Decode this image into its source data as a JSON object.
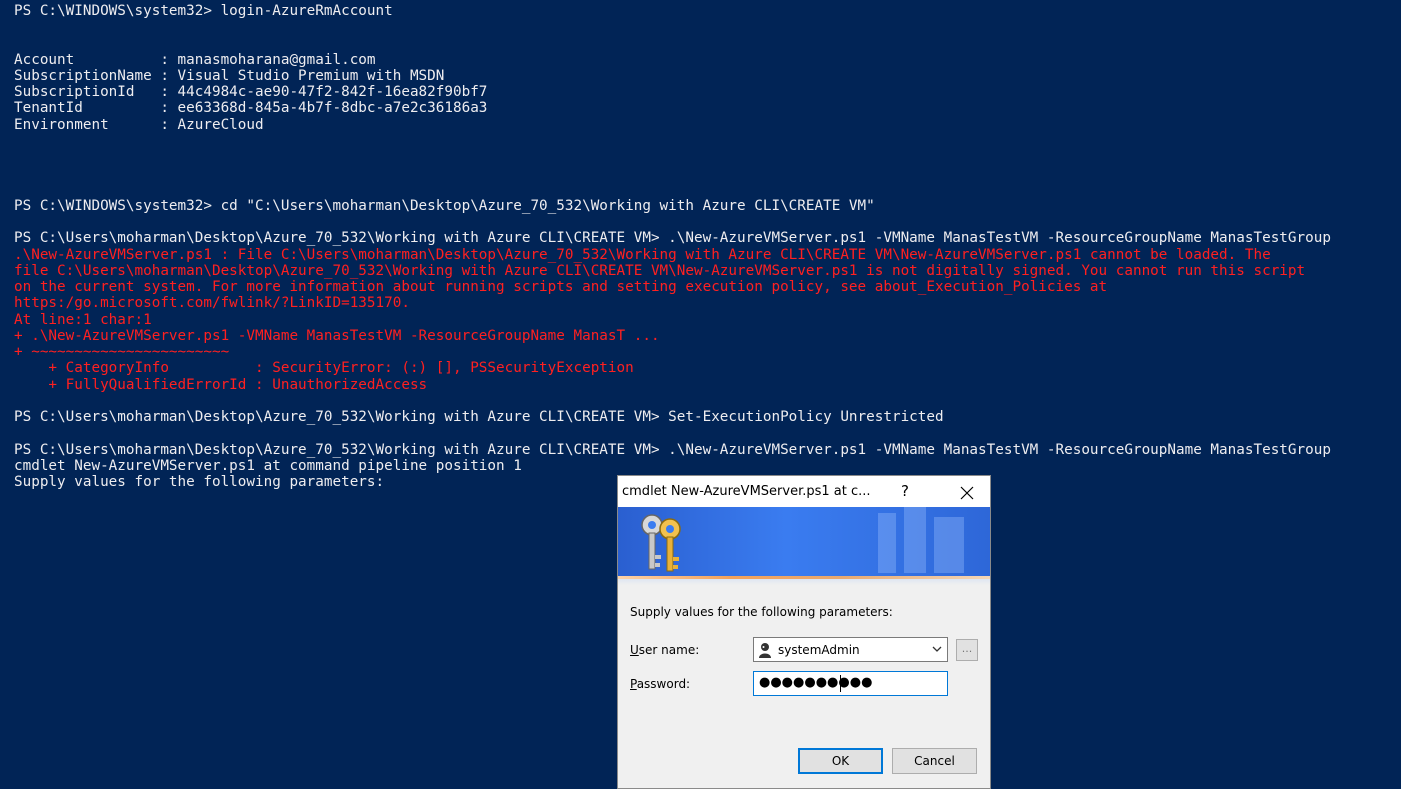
{
  "console": {
    "lines": [
      {
        "text": "PS C:\\WINDOWS\\system32> login-AzureRmAccount",
        "error": false
      },
      {
        "text": "Account          : manasmoharana@gmail.com",
        "error": false
      },
      {
        "text": "SubscriptionName : Visual Studio Premium with MSDN",
        "error": false
      },
      {
        "text": "SubscriptionId   : 44c4984c-ae90-47f2-842f-16ea82f90bf7",
        "error": false
      },
      {
        "text": "TenantId         : ee63368d-845a-4b7f-8dbc-a7e2c36186a3",
        "error": false
      },
      {
        "text": "Environment      : AzureCloud",
        "error": false
      },
      {
        "text": "PS C:\\WINDOWS\\system32> cd \"C:\\Users\\moharman\\Desktop\\Azure_70_532\\Working with Azure CLI\\CREATE VM\"",
        "error": false
      },
      {
        "text": "PS C:\\Users\\moharman\\Desktop\\Azure_70_532\\Working with Azure CLI\\CREATE VM> .\\New-AzureVMServer.ps1 -VMName ManasTestVM -ResourceGroupName ManasTestGroup",
        "error": false
      },
      {
        "text": ".\\New-AzureVMServer.ps1 : File C:\\Users\\moharman\\Desktop\\Azure_70_532\\Working with Azure CLI\\CREATE VM\\New-AzureVMServer.ps1 cannot be loaded. The",
        "error": true
      },
      {
        "text": "file C:\\Users\\moharman\\Desktop\\Azure_70_532\\Working with Azure CLI\\CREATE VM\\New-AzureVMServer.ps1 is not digitally signed. You cannot run this script",
        "error": true
      },
      {
        "text": "on the current system. For more information about running scripts and setting execution policy, see about_Execution_Policies at",
        "error": true
      },
      {
        "text": "https:/go.microsoft.com/fwlink/?LinkID=135170.",
        "error": true
      },
      {
        "text": "At line:1 char:1",
        "error": true
      },
      {
        "text": "+ .\\New-AzureVMServer.ps1 -VMName ManasTestVM -ResourceGroupName ManasT ...",
        "error": true
      },
      {
        "text": "+ ~~~~~~~~~~~~~~~~~~~~~~~",
        "error": true
      },
      {
        "text": "    + CategoryInfo          : SecurityError: (:) [], PSSecurityException",
        "error": true
      },
      {
        "text": "    + FullyQualifiedErrorId : UnauthorizedAccess",
        "error": true
      },
      {
        "text": "PS C:\\Users\\moharman\\Desktop\\Azure_70_532\\Working with Azure CLI\\CREATE VM> Set-ExecutionPolicy Unrestricted",
        "error": false
      },
      {
        "text": "PS C:\\Users\\moharman\\Desktop\\Azure_70_532\\Working with Azure CLI\\CREATE VM> .\\New-AzureVMServer.ps1 -VMName ManasTestVM -ResourceGroupName ManasTestGroup",
        "error": false
      },
      {
        "text": "cmdlet New-AzureVMServer.ps1 at command pipeline position 1",
        "error": false
      },
      {
        "text": "Supply values for the following parameters:",
        "error": false
      }
    ]
  },
  "dialog": {
    "title": "cmdlet New-AzureVMServer.ps1 at c...",
    "help_label": "?",
    "close_label": "✕",
    "prompt": "Supply values for the following parameters:",
    "username_label_key": "U",
    "username_label_rest": "ser name:",
    "username_value": "systemAdmin",
    "browse_label": "...",
    "password_label_key": "P",
    "password_label_rest": "assword:",
    "password_value": "●●●●●●●●●●",
    "ok_label": "OK",
    "cancel_label": "Cancel",
    "icons": [
      "keys-icon",
      "user-icon",
      "chevron-down-icon",
      "close-icon",
      "help-icon"
    ],
    "colors": {
      "banner": "#3a7cf0",
      "focus": "#0078d7",
      "console_bg": "#012456",
      "error_text": "#ff2020"
    }
  }
}
